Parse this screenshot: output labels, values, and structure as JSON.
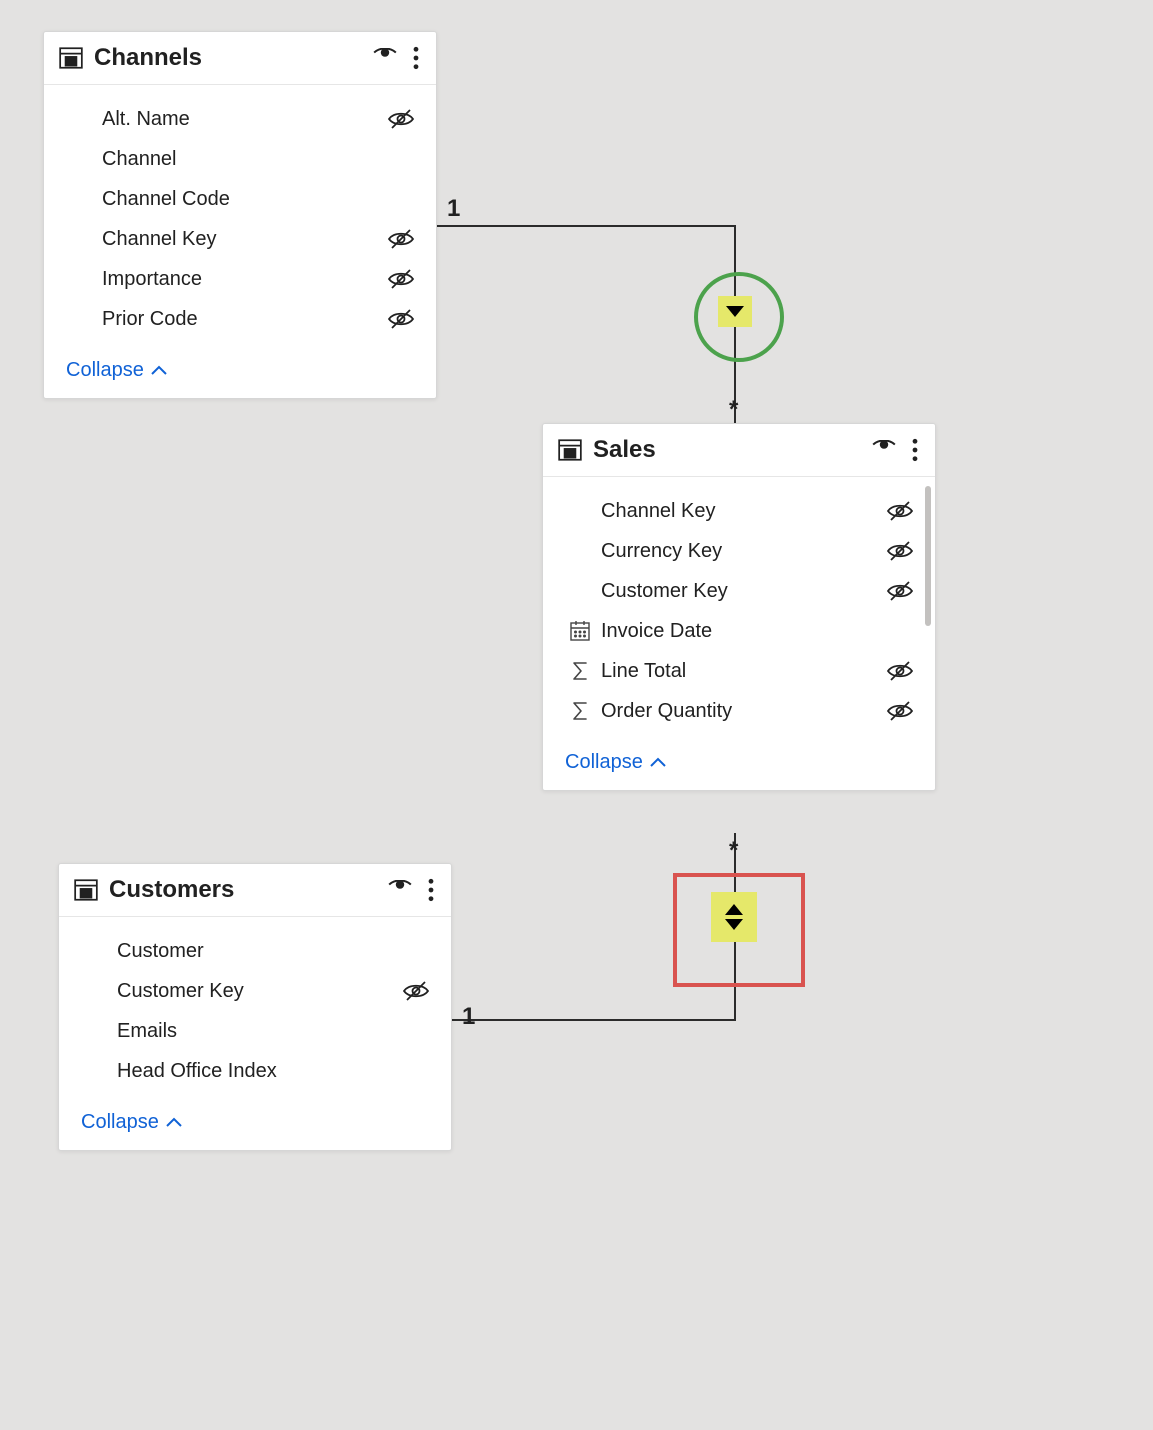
{
  "collapse_label": "Collapse",
  "relationship_labels": {
    "one": "1",
    "many": "*"
  },
  "tables": {
    "channels": {
      "title": "Channels",
      "fields": [
        {
          "name": "Alt. Name",
          "type": "",
          "hidden": true
        },
        {
          "name": "Channel",
          "type": "",
          "hidden": false
        },
        {
          "name": "Channel Code",
          "type": "",
          "hidden": false
        },
        {
          "name": "Channel Key",
          "type": "",
          "hidden": true
        },
        {
          "name": "Importance",
          "type": "",
          "hidden": true
        },
        {
          "name": "Prior Code",
          "type": "",
          "hidden": true
        }
      ]
    },
    "sales": {
      "title": "Sales",
      "fields": [
        {
          "name": "Channel Key",
          "type": "",
          "hidden": true
        },
        {
          "name": "Currency Key",
          "type": "",
          "hidden": true
        },
        {
          "name": "Customer Key",
          "type": "",
          "hidden": true
        },
        {
          "name": "Invoice Date",
          "type": "date",
          "hidden": false
        },
        {
          "name": "Line Total",
          "type": "sum",
          "hidden": true
        },
        {
          "name": "Order Quantity",
          "type": "sum",
          "hidden": true
        }
      ]
    },
    "customers": {
      "title": "Customers",
      "fields": [
        {
          "name": "Customer",
          "type": "",
          "hidden": false
        },
        {
          "name": "Customer Key",
          "type": "",
          "hidden": true
        },
        {
          "name": "Emails",
          "type": "",
          "hidden": false
        },
        {
          "name": "Head Office Index",
          "type": "",
          "hidden": false
        }
      ]
    }
  }
}
